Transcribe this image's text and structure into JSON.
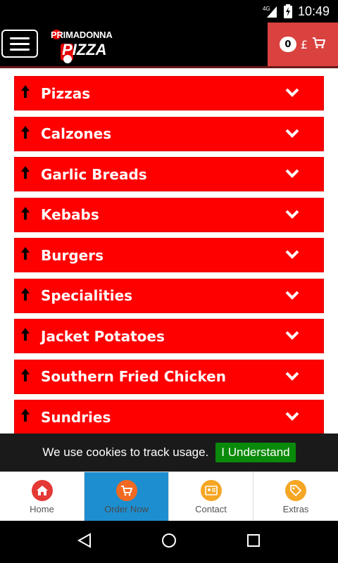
{
  "status_bar": {
    "network": "4G",
    "time": "10:49"
  },
  "header": {
    "logo": {
      "line1": "PRIMADONNA",
      "line2": "PIZZA"
    },
    "cart": {
      "count": "0",
      "currency": "£"
    }
  },
  "categories": [
    {
      "label": "Pizzas"
    },
    {
      "label": "Calzones"
    },
    {
      "label": "Garlic Breads"
    },
    {
      "label": "Kebabs"
    },
    {
      "label": "Burgers"
    },
    {
      "label": "Specialities"
    },
    {
      "label": "Jacket Potatoes"
    },
    {
      "label": "Southern Fried Chicken"
    },
    {
      "label": "Sundries"
    }
  ],
  "cookie_bar": {
    "text": "We use cookies to track usage.",
    "button_label": "I Understand"
  },
  "bottom_nav": [
    {
      "label": "Home",
      "icon": "home-icon",
      "color": "#e53935"
    },
    {
      "label": "Order Now",
      "icon": "cart-icon",
      "color": "#f26a21"
    },
    {
      "label": "Contact",
      "icon": "contact-card-icon",
      "color": "#f5a623"
    },
    {
      "label": "Extras",
      "icon": "tag-icon",
      "color": "#f5a623"
    }
  ],
  "colors": {
    "category_bg": "#ff0000",
    "cart_bg": "#d9423f",
    "active_nav": "#1d8ed0",
    "cookie_button": "#0a8a0a"
  }
}
